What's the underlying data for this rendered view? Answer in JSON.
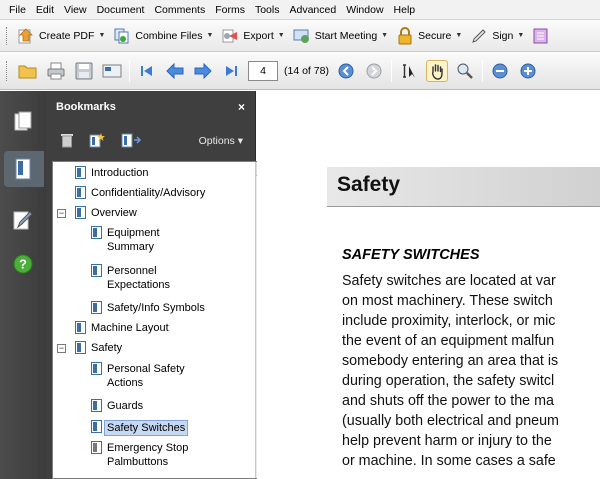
{
  "menu": [
    "File",
    "Edit",
    "View",
    "Document",
    "Comments",
    "Forms",
    "Tools",
    "Advanced",
    "Window",
    "Help"
  ],
  "toolbar1": {
    "buttons": [
      {
        "label": "Create PDF",
        "icon": "create-pdf-icon"
      },
      {
        "label": "Combine Files",
        "icon": "combine-files-icon"
      },
      {
        "label": "Export",
        "icon": "export-icon"
      },
      {
        "label": "Start Meeting",
        "icon": "start-meeting-icon"
      },
      {
        "label": "Secure",
        "icon": "lock-icon"
      },
      {
        "label": "Sign",
        "icon": "pen-icon"
      }
    ]
  },
  "toolbar2": {
    "page_number": "4",
    "page_count": "(14 of 78)"
  },
  "bookmarks": {
    "title": "Bookmarks",
    "close": "×",
    "options_label": "Options ▾",
    "items": [
      {
        "label": "Introduction"
      },
      {
        "label": "Confidentiality/Advisory"
      },
      {
        "label": "Overview"
      },
      {
        "label": "Equipment"
      },
      {
        "label": "Summary"
      },
      {
        "label": "Personnel"
      },
      {
        "label": "Expectations"
      },
      {
        "label": "Safety/Info Symbols"
      },
      {
        "label": "Machine Layout"
      },
      {
        "label": "Safety"
      },
      {
        "label": "Personal Safety"
      },
      {
        "label": "Actions"
      },
      {
        "label": "Guards"
      },
      {
        "label": "Safety Switches"
      },
      {
        "label": "Emergency Stop"
      },
      {
        "label": "Palmbuttons"
      }
    ]
  },
  "document": {
    "section_title": "Safety",
    "heading": "SAFETY SWITCHES",
    "lines": [
      "Safety switches are located at var",
      "on most machinery.  These switch",
      "include proximity, interlock, or mic",
      "the event of an equipment malfun",
      "somebody entering an area that is",
      "during operation, the safety switcl",
      "and shuts off the power to the ma",
      "(usually both electrical and pneum",
      "help prevent harm or injury to the",
      "or machine.  In some cases a safe"
    ]
  }
}
